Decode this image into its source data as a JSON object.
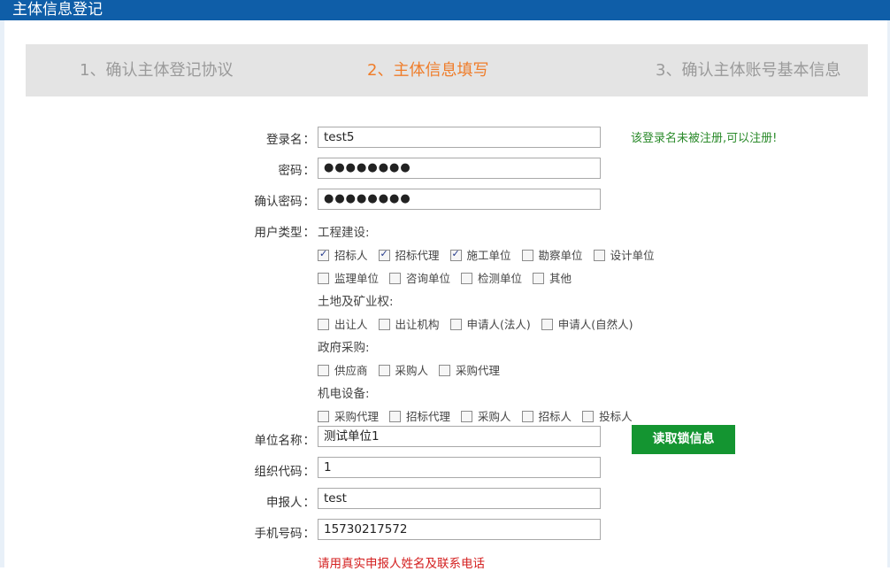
{
  "header": {
    "title": "主体信息登记"
  },
  "steps": [
    {
      "label": "1、确认主体登记协议"
    },
    {
      "label": "2、主体信息填写"
    },
    {
      "label": "3、确认主体账号基本信息"
    }
  ],
  "form": {
    "login_name": {
      "label": "登录名",
      "value": "test5",
      "hint": "该登录名未被注册,可以注册!"
    },
    "password": {
      "label": "密码",
      "value": "●●●●●●●●"
    },
    "confirm_password": {
      "label": "确认密码",
      "value": "●●●●●●●●"
    },
    "user_type": {
      "label": "用户类型",
      "groups": [
        {
          "title": "工程建设:",
          "rows": [
            [
              {
                "label": "招标人",
                "checked": true
              },
              {
                "label": "招标代理",
                "checked": true
              },
              {
                "label": "施工单位",
                "checked": true
              },
              {
                "label": "勘察单位",
                "checked": false
              },
              {
                "label": "设计单位",
                "checked": false
              }
            ],
            [
              {
                "label": "监理单位",
                "checked": false
              },
              {
                "label": "咨询单位",
                "checked": false
              },
              {
                "label": "检测单位",
                "checked": false
              },
              {
                "label": "其他",
                "checked": false
              }
            ]
          ]
        },
        {
          "title": "土地及矿业权:",
          "rows": [
            [
              {
                "label": "出让人",
                "checked": false
              },
              {
                "label": "出让机构",
                "checked": false
              },
              {
                "label": "申请人(法人)",
                "checked": false
              },
              {
                "label": "申请人(自然人)",
                "checked": false
              }
            ]
          ]
        },
        {
          "title": "政府采购:",
          "rows": [
            [
              {
                "label": "供应商",
                "checked": false
              },
              {
                "label": "采购人",
                "checked": false
              },
              {
                "label": "采购代理",
                "checked": false
              }
            ]
          ]
        },
        {
          "title": "机电设备:",
          "rows": [
            [
              {
                "label": "采购代理",
                "checked": false
              },
              {
                "label": "招标代理",
                "checked": false
              },
              {
                "label": "采购人",
                "checked": false
              },
              {
                "label": "招标人",
                "checked": false
              },
              {
                "label": "投标人",
                "checked": false
              }
            ]
          ]
        }
      ]
    },
    "unit_name": {
      "label": "单位名称",
      "value": "测试单位1",
      "button": "读取锁信息"
    },
    "org_code": {
      "label": "组织代码",
      "value": "1"
    },
    "applicant": {
      "label": "申报人",
      "value": "test"
    },
    "phone": {
      "label": "手机号码",
      "value": "15730217572"
    },
    "note": "请用真实申报人姓名及联系电话"
  },
  "colors": {
    "header_bg": "#0f5ea8",
    "active_step": "#ef7d2a",
    "button_bg": "#149531",
    "hint_green": "#2a8a2a",
    "note_red": "#d42020"
  }
}
